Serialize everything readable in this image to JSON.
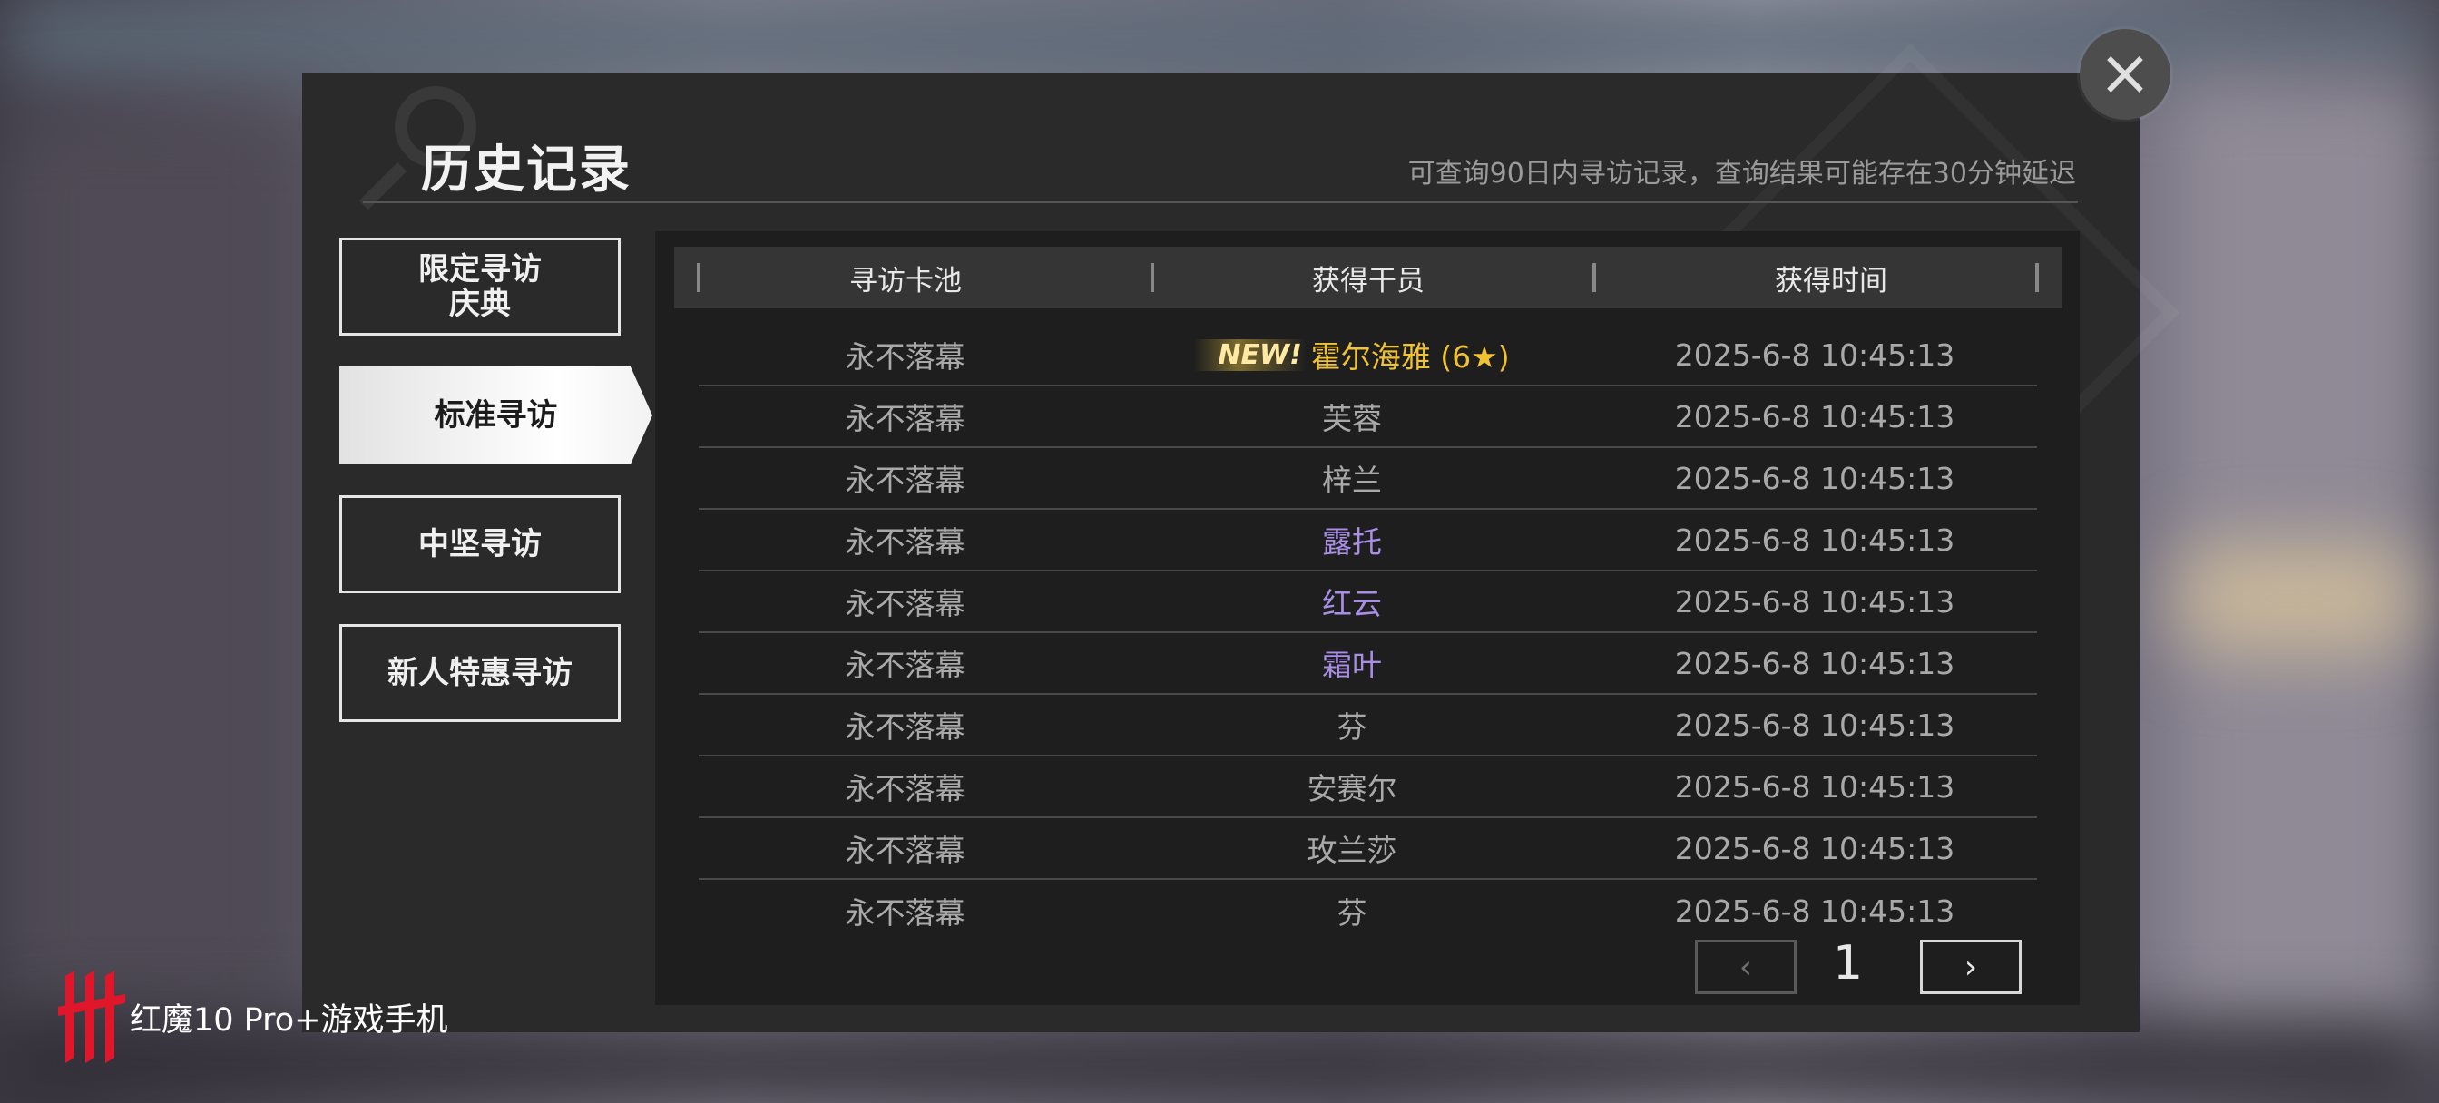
{
  "header": {
    "title": "历史记录",
    "subtitle": "可查询90日内寻访记录，查询结果可能存在30分钟延迟",
    "close_icon": "×"
  },
  "sidebar": {
    "items": [
      {
        "label": "限定寻访\n庆典",
        "selected": false
      },
      {
        "label": "标准寻访",
        "selected": true
      },
      {
        "label": "中坚寻访",
        "selected": false
      },
      {
        "label": "新人特惠寻访",
        "selected": false
      }
    ]
  },
  "table": {
    "headers": [
      "寻访卡池",
      "获得干员",
      "获得时间"
    ],
    "new_tag": "NEW!",
    "rows": [
      {
        "pool": "永不落幕",
        "operator": "霍尔海雅 (6★)",
        "time": "2025-6-8 10:45:13",
        "rarity_color": "#f1c232",
        "is_new": true
      },
      {
        "pool": "永不落幕",
        "operator": "芙蓉",
        "time": "2025-6-8 10:45:13",
        "rarity_color": "#a9a9a9",
        "is_new": false
      },
      {
        "pool": "永不落幕",
        "operator": "梓兰",
        "time": "2025-6-8 10:45:13",
        "rarity_color": "#a9a9a9",
        "is_new": false
      },
      {
        "pool": "永不落幕",
        "operator": "露托",
        "time": "2025-6-8 10:45:13",
        "rarity_color": "#a98ee6",
        "is_new": false
      },
      {
        "pool": "永不落幕",
        "operator": "红云",
        "time": "2025-6-8 10:45:13",
        "rarity_color": "#a98ee6",
        "is_new": false
      },
      {
        "pool": "永不落幕",
        "operator": "霜叶",
        "time": "2025-6-8 10:45:13",
        "rarity_color": "#a98ee6",
        "is_new": false
      },
      {
        "pool": "永不落幕",
        "operator": "芬",
        "time": "2025-6-8 10:45:13",
        "rarity_color": "#a9a9a9",
        "is_new": false
      },
      {
        "pool": "永不落幕",
        "operator": "安赛尔",
        "time": "2025-6-8 10:45:13",
        "rarity_color": "#a9a9a9",
        "is_new": false
      },
      {
        "pool": "永不落幕",
        "operator": "玫兰莎",
        "time": "2025-6-8 10:45:13",
        "rarity_color": "#a9a9a9",
        "is_new": false
      },
      {
        "pool": "永不落幕",
        "operator": "芬",
        "time": "2025-6-8 10:45:13",
        "rarity_color": "#a9a9a9",
        "is_new": false
      }
    ]
  },
  "pagination": {
    "prev_icon": "‹",
    "page": "1",
    "next_icon": "›"
  },
  "watermark": {
    "brand": "红魔10 Pro+游戏手机"
  }
}
